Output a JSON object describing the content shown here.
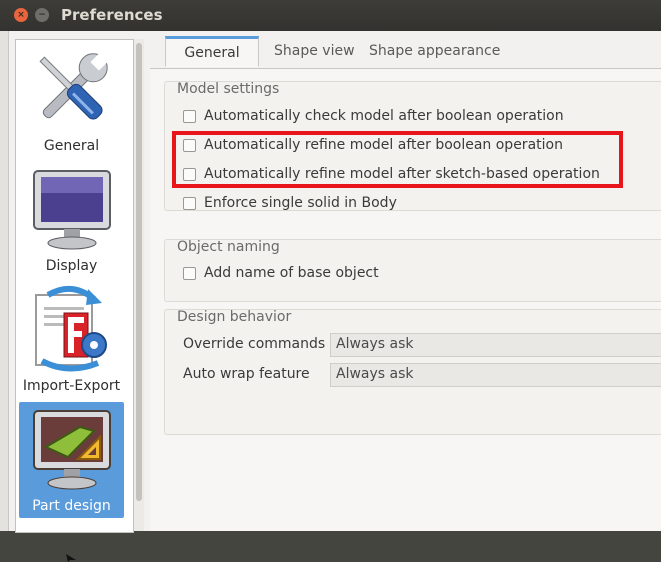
{
  "window": {
    "title": "Preferences",
    "close_glyph": "×",
    "minimize_glyph": "−"
  },
  "sidebar": {
    "items": [
      {
        "label": "General",
        "icon": "wrench-screwdriver-icon",
        "selected": false
      },
      {
        "label": "Display",
        "icon": "monitor-icon",
        "selected": false
      },
      {
        "label": "Import-Export",
        "icon": "import-export-icon",
        "selected": false
      },
      {
        "label": "Part design",
        "icon": "part-design-icon",
        "selected": true
      }
    ]
  },
  "tabs": [
    {
      "label": "General",
      "active": true
    },
    {
      "label": "Shape view",
      "active": false
    },
    {
      "label": "Shape appearance",
      "active": false
    }
  ],
  "model_settings": {
    "title": "Model settings",
    "options": [
      {
        "label": "Automatically check model after boolean operation",
        "checked": false
      },
      {
        "label": "Automatically refine model after boolean operation",
        "checked": false
      },
      {
        "label": "Automatically refine model after sketch-based operation",
        "checked": false
      },
      {
        "label": "Enforce single solid in Body",
        "checked": false
      }
    ]
  },
  "object_naming": {
    "title": "Object naming",
    "options": [
      {
        "label": "Add name of base object",
        "checked": false
      }
    ]
  },
  "design_behavior": {
    "title": "Design behavior",
    "rows": [
      {
        "label": "Override commands",
        "value": "Always ask"
      },
      {
        "label": "Auto wrap feature",
        "value": "Always ask"
      }
    ]
  },
  "colors": {
    "accent": "#5a9bdc",
    "highlight": "#e8151b",
    "titlebar": "#3d3c38",
    "close_button": "#e9653f"
  }
}
